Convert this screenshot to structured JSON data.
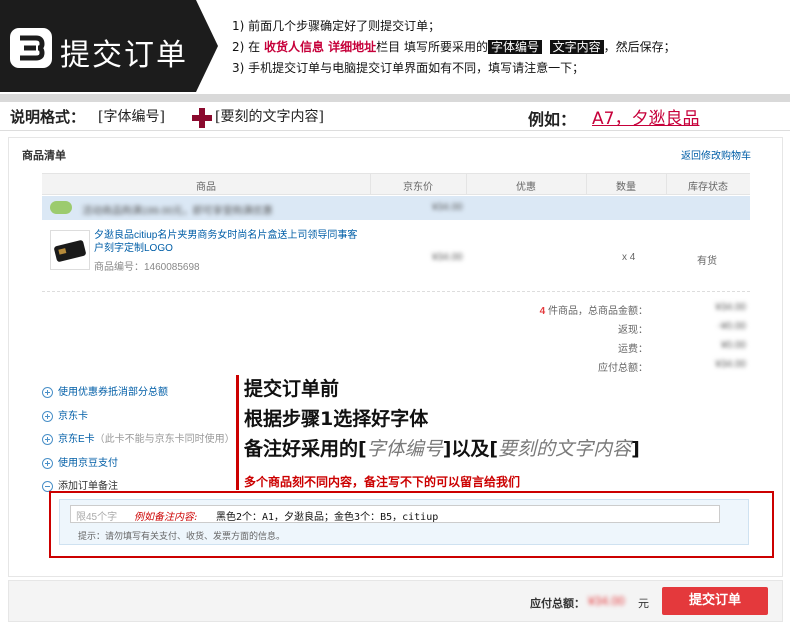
{
  "banner": {
    "step_number": "3",
    "title": "提交订单",
    "steps": {
      "s1": "1) 前面几个步骤确定好了则提交订单；",
      "s2_prefix": "2) 在 ",
      "s2_hl": "收货人信息 详细地址",
      "s2_mid": "栏目 填写所要采用的",
      "s2_tag1": "字体编号",
      "s2_tag2": "文字内容",
      "s2_suffix": "，然后保存；",
      "s3": "3) 手机提交订单与电脑提交订单界面如有不同，填写请注意一下；"
    }
  },
  "format": {
    "label": "说明格式：",
    "box1": "[字体编号]",
    "box2": "[要刻的文字内容]",
    "example_label": "例如：",
    "example_value": "A7，夕逖良品"
  },
  "panel": {
    "title": "商品清单",
    "back_link": "返回修改购物车",
    "headers": [
      "商品",
      "京东价",
      "优惠",
      "数量",
      "库存状态"
    ],
    "promo": {
      "text": "活动商品购满199.00元，即可享受购满优惠",
      "price": "¥34.00"
    },
    "item": {
      "name": "夕逖良品citiup名片夹男商务女时尚名片盒送上司领导同事客户刻字定制LOGO",
      "code": "商品编号：1460085698",
      "price": "¥34.00",
      "qty": "x 4",
      "stock": "有货"
    },
    "summary": {
      "count": "4",
      "count_suffix": " 件商品，总商品金额：",
      "rows": [
        {
          "label": "返现：",
          "value": "-¥0.00"
        },
        {
          "label": "运费：",
          "value": "¥0.00"
        },
        {
          "label": "应付总额：",
          "value": "¥34.00"
        }
      ],
      "goods_total": "¥34.00"
    }
  },
  "options": [
    {
      "label": "使用优惠券抵消部分总额",
      "icon": "plus"
    },
    {
      "label": "京东卡",
      "icon": "plus"
    },
    {
      "label": "京东E卡",
      "note": "（此卡不能与京东卡同时使用）",
      "icon": "plus"
    },
    {
      "label": "使用京豆支付",
      "icon": "plus"
    },
    {
      "label": "添加订单备注",
      "icon": "minus"
    }
  ],
  "annotation": {
    "line1": "提交订单前",
    "line2": "根据步骤1选择好字体",
    "line3_a": "备注好采用的[",
    "line3_b": "字体编号",
    "line3_c": "]以及[",
    "line3_d": "要刻的文字内容",
    "line3_e": "]",
    "note": "多个商品刻不同内容，备注写不下的可以留言给我们"
  },
  "remark": {
    "placeholder": "限45个字",
    "example_label": "例如备注内容:",
    "example_value": "黑色2个：A1，夕逖良品；金色3个：B5，citiup",
    "hint": "提示：请勿填写有关支付、收货、发票方面的信息。"
  },
  "footer": {
    "total_label": "应付总额：",
    "total_value": "¥34.00",
    "total_unit": "元",
    "submit_label": "提交订单"
  },
  "colors": {
    "accent_red": "#e4393c",
    "brand_dark_red": "#8b0a2e",
    "link_blue": "#005ea7"
  }
}
